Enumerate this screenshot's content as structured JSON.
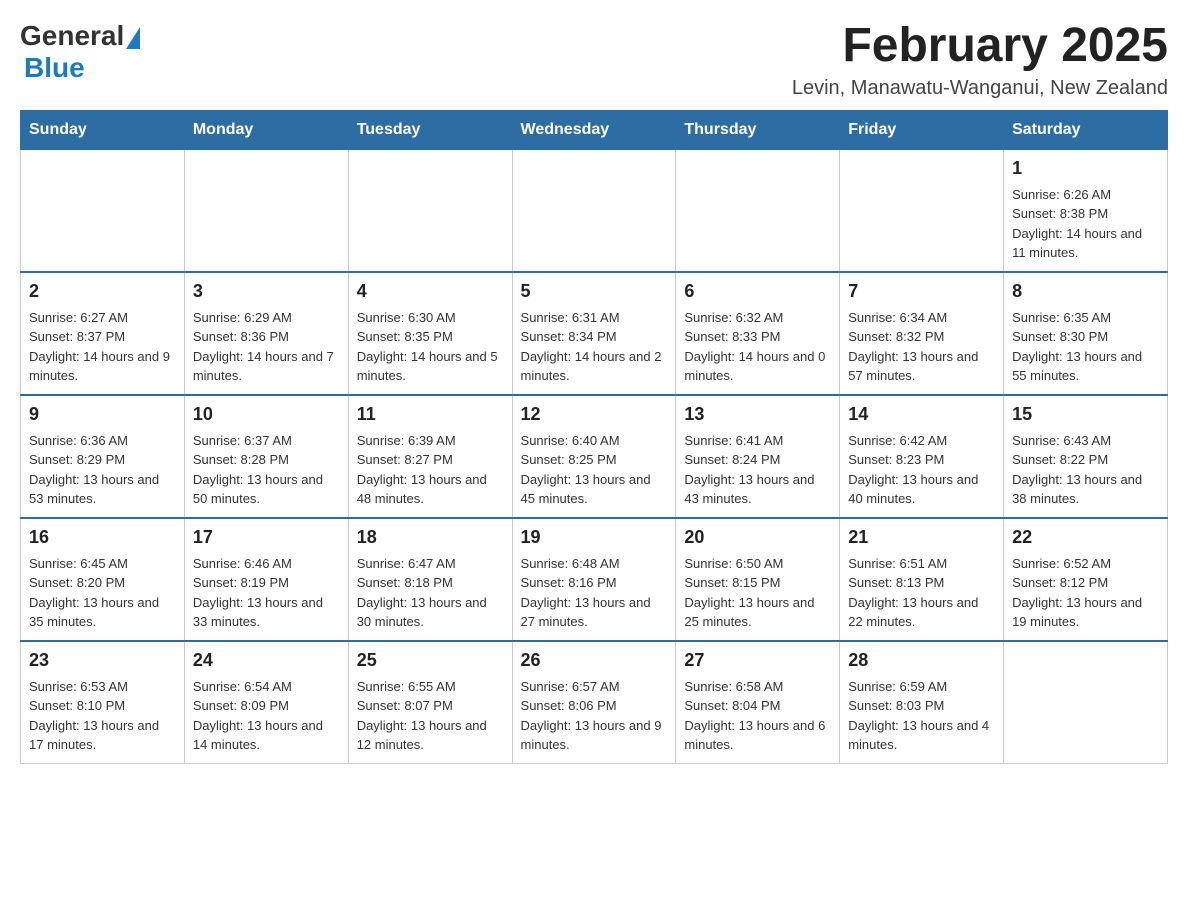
{
  "header": {
    "logo": {
      "general": "General",
      "blue": "Blue"
    },
    "title": "February 2025",
    "location": "Levin, Manawatu-Wanganui, New Zealand"
  },
  "days_of_week": [
    "Sunday",
    "Monday",
    "Tuesday",
    "Wednesday",
    "Thursday",
    "Friday",
    "Saturday"
  ],
  "weeks": [
    {
      "days": [
        {
          "number": "",
          "info": ""
        },
        {
          "number": "",
          "info": ""
        },
        {
          "number": "",
          "info": ""
        },
        {
          "number": "",
          "info": ""
        },
        {
          "number": "",
          "info": ""
        },
        {
          "number": "",
          "info": ""
        },
        {
          "number": "1",
          "info": "Sunrise: 6:26 AM\nSunset: 8:38 PM\nDaylight: 14 hours and 11 minutes."
        }
      ]
    },
    {
      "days": [
        {
          "number": "2",
          "info": "Sunrise: 6:27 AM\nSunset: 8:37 PM\nDaylight: 14 hours and 9 minutes."
        },
        {
          "number": "3",
          "info": "Sunrise: 6:29 AM\nSunset: 8:36 PM\nDaylight: 14 hours and 7 minutes."
        },
        {
          "number": "4",
          "info": "Sunrise: 6:30 AM\nSunset: 8:35 PM\nDaylight: 14 hours and 5 minutes."
        },
        {
          "number": "5",
          "info": "Sunrise: 6:31 AM\nSunset: 8:34 PM\nDaylight: 14 hours and 2 minutes."
        },
        {
          "number": "6",
          "info": "Sunrise: 6:32 AM\nSunset: 8:33 PM\nDaylight: 14 hours and 0 minutes."
        },
        {
          "number": "7",
          "info": "Sunrise: 6:34 AM\nSunset: 8:32 PM\nDaylight: 13 hours and 57 minutes."
        },
        {
          "number": "8",
          "info": "Sunrise: 6:35 AM\nSunset: 8:30 PM\nDaylight: 13 hours and 55 minutes."
        }
      ]
    },
    {
      "days": [
        {
          "number": "9",
          "info": "Sunrise: 6:36 AM\nSunset: 8:29 PM\nDaylight: 13 hours and 53 minutes."
        },
        {
          "number": "10",
          "info": "Sunrise: 6:37 AM\nSunset: 8:28 PM\nDaylight: 13 hours and 50 minutes."
        },
        {
          "number": "11",
          "info": "Sunrise: 6:39 AM\nSunset: 8:27 PM\nDaylight: 13 hours and 48 minutes."
        },
        {
          "number": "12",
          "info": "Sunrise: 6:40 AM\nSunset: 8:25 PM\nDaylight: 13 hours and 45 minutes."
        },
        {
          "number": "13",
          "info": "Sunrise: 6:41 AM\nSunset: 8:24 PM\nDaylight: 13 hours and 43 minutes."
        },
        {
          "number": "14",
          "info": "Sunrise: 6:42 AM\nSunset: 8:23 PM\nDaylight: 13 hours and 40 minutes."
        },
        {
          "number": "15",
          "info": "Sunrise: 6:43 AM\nSunset: 8:22 PM\nDaylight: 13 hours and 38 minutes."
        }
      ]
    },
    {
      "days": [
        {
          "number": "16",
          "info": "Sunrise: 6:45 AM\nSunset: 8:20 PM\nDaylight: 13 hours and 35 minutes."
        },
        {
          "number": "17",
          "info": "Sunrise: 6:46 AM\nSunset: 8:19 PM\nDaylight: 13 hours and 33 minutes."
        },
        {
          "number": "18",
          "info": "Sunrise: 6:47 AM\nSunset: 8:18 PM\nDaylight: 13 hours and 30 minutes."
        },
        {
          "number": "19",
          "info": "Sunrise: 6:48 AM\nSunset: 8:16 PM\nDaylight: 13 hours and 27 minutes."
        },
        {
          "number": "20",
          "info": "Sunrise: 6:50 AM\nSunset: 8:15 PM\nDaylight: 13 hours and 25 minutes."
        },
        {
          "number": "21",
          "info": "Sunrise: 6:51 AM\nSunset: 8:13 PM\nDaylight: 13 hours and 22 minutes."
        },
        {
          "number": "22",
          "info": "Sunrise: 6:52 AM\nSunset: 8:12 PM\nDaylight: 13 hours and 19 minutes."
        }
      ]
    },
    {
      "days": [
        {
          "number": "23",
          "info": "Sunrise: 6:53 AM\nSunset: 8:10 PM\nDaylight: 13 hours and 17 minutes."
        },
        {
          "number": "24",
          "info": "Sunrise: 6:54 AM\nSunset: 8:09 PM\nDaylight: 13 hours and 14 minutes."
        },
        {
          "number": "25",
          "info": "Sunrise: 6:55 AM\nSunset: 8:07 PM\nDaylight: 13 hours and 12 minutes."
        },
        {
          "number": "26",
          "info": "Sunrise: 6:57 AM\nSunset: 8:06 PM\nDaylight: 13 hours and 9 minutes."
        },
        {
          "number": "27",
          "info": "Sunrise: 6:58 AM\nSunset: 8:04 PM\nDaylight: 13 hours and 6 minutes."
        },
        {
          "number": "28",
          "info": "Sunrise: 6:59 AM\nSunset: 8:03 PM\nDaylight: 13 hours and 4 minutes."
        },
        {
          "number": "",
          "info": ""
        }
      ]
    }
  ]
}
